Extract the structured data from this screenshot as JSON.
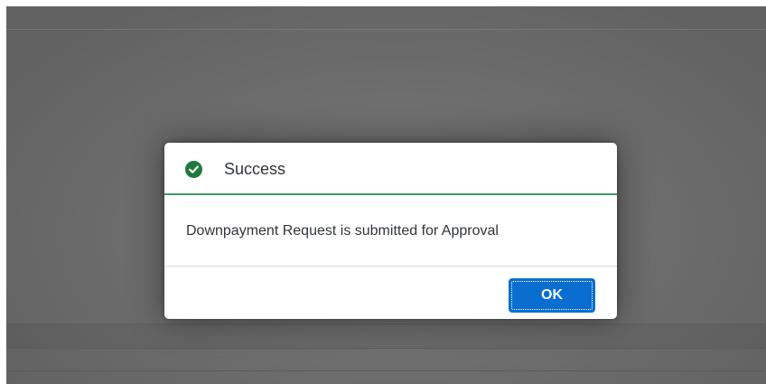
{
  "dialog": {
    "title": "Success",
    "message": "Downpayment Request is submitted for Approval",
    "ok_label": "OK",
    "status": "success",
    "accent_color": "#3d9a66",
    "icon": "check-circle-icon"
  },
  "colors": {
    "button": "#0a6ed1",
    "success_icon": "#1f7a3c"
  }
}
